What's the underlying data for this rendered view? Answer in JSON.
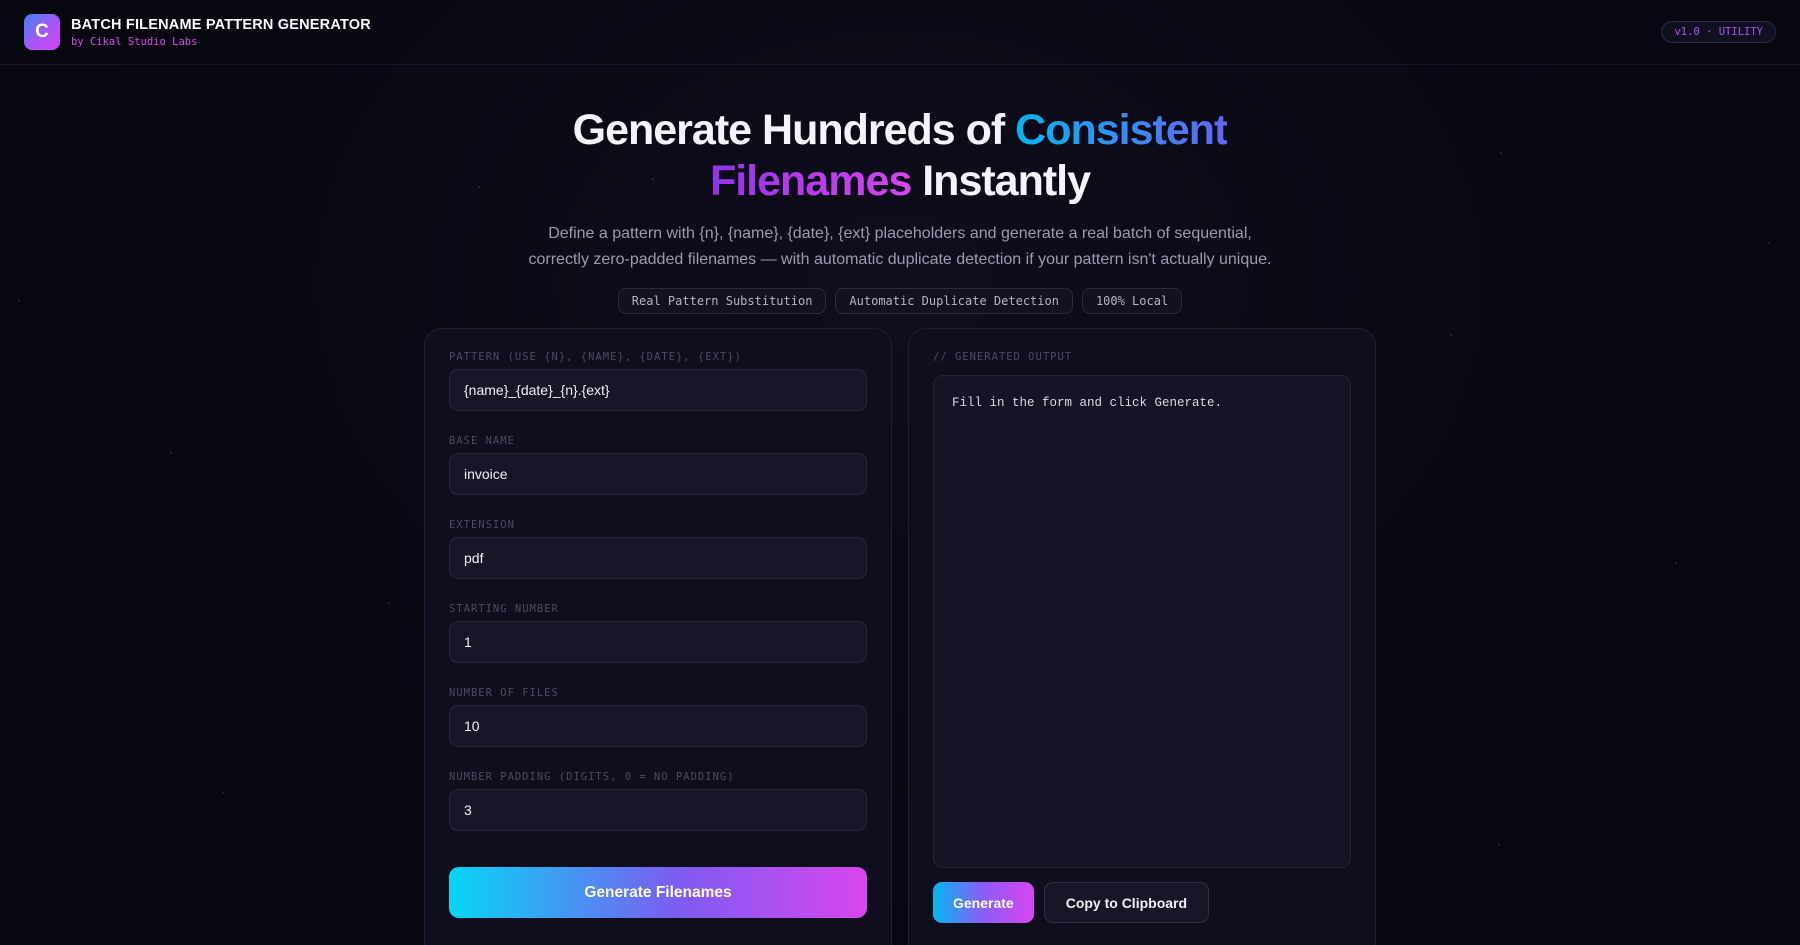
{
  "header": {
    "logo_letter": "C",
    "title": "BATCH FILENAME PATTERN GENERATOR",
    "subtitle": "by Cikal Studio Labs",
    "version": "v1.0 · UTILITY"
  },
  "hero": {
    "title_part1": "Generate Hundreds of ",
    "title_highlight1": "Consistent",
    "title_highlight2": "Filenames",
    "title_part2": " Instantly",
    "description": "Define a pattern with {n}, {name}, {date}, {ext} placeholders and generate a real batch of sequential, correctly zero-padded filenames — with automatic duplicate detection if your pattern isn't actually unique.",
    "chips": [
      "Real Pattern Substitution",
      "Automatic Duplicate Detection",
      "100% Local"
    ]
  },
  "form": {
    "fields": [
      {
        "label": "Pattern (use {n}, {name}, {date}, {ext})",
        "value": "{name}_{date}_{n}.{ext}"
      },
      {
        "label": "Base Name",
        "value": "invoice"
      },
      {
        "label": "Extension",
        "value": "pdf"
      },
      {
        "label": "Starting Number",
        "value": "1"
      },
      {
        "label": "Number of Files",
        "value": "10"
      },
      {
        "label": "Number Padding (digits, 0 = no padding)",
        "value": "3"
      }
    ],
    "submit_label": "Generate Filenames"
  },
  "output": {
    "label": "// Generated Output",
    "placeholder_text": "Fill in the form and click Generate.",
    "generate_label": "Generate",
    "copy_label": "Copy to Clipboard"
  },
  "colors": {
    "accent_cyan": "#06b6f0",
    "accent_purple": "#a855f7",
    "accent_magenta": "#d946ef",
    "background": "#07070f"
  }
}
